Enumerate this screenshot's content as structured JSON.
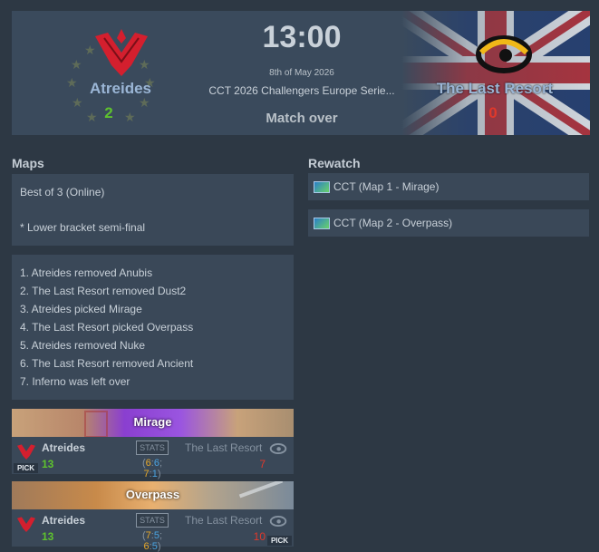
{
  "match": {
    "time": "13:00",
    "date": "8th of May 2026",
    "event": "CCT 2026 Challengers Europe Serie...",
    "status": "Match over",
    "team1": {
      "name": "Atreides",
      "score": "2",
      "color": "#e02030"
    },
    "team2": {
      "name": "The Last Resort",
      "score": "0",
      "color": "#f0b818"
    }
  },
  "maps_section": {
    "title": "Maps",
    "format": "Best of 3 (Online)",
    "note": "* Lower bracket semi-final",
    "veto": [
      "1. Atreides removed Anubis",
      "2. The Last Resort removed Dust2",
      "3. Atreides picked Mirage",
      "4. The Last Resort picked Overpass",
      "5. Atreides removed Nuke",
      "6. The Last Resort removed Ancient",
      "7. Inferno was left over"
    ],
    "results": [
      {
        "map": "Mirage",
        "team1": "Atreides",
        "team2": "The Last Resort",
        "score1": "13",
        "score2": "7",
        "stats_label": "STATS",
        "half1_ct": "6",
        "half1_t": "6",
        "half2_ct": "7",
        "half2_t": "1",
        "pick_label": "PICK",
        "picked_by": "team1"
      },
      {
        "map": "Overpass",
        "team1": "Atreides",
        "team2": "The Last Resort",
        "score1": "13",
        "score2": "10",
        "stats_label": "STATS",
        "half1_ct": "7",
        "half1_t": "5",
        "half2_ct": "6",
        "half2_t": "5",
        "pick_label": "PICK",
        "picked_by": "team2"
      }
    ]
  },
  "rewatch_section": {
    "title": "Rewatch",
    "items": [
      "CCT (Map 1 - Mirage)",
      "CCT (Map 2 - Overpass)"
    ]
  }
}
